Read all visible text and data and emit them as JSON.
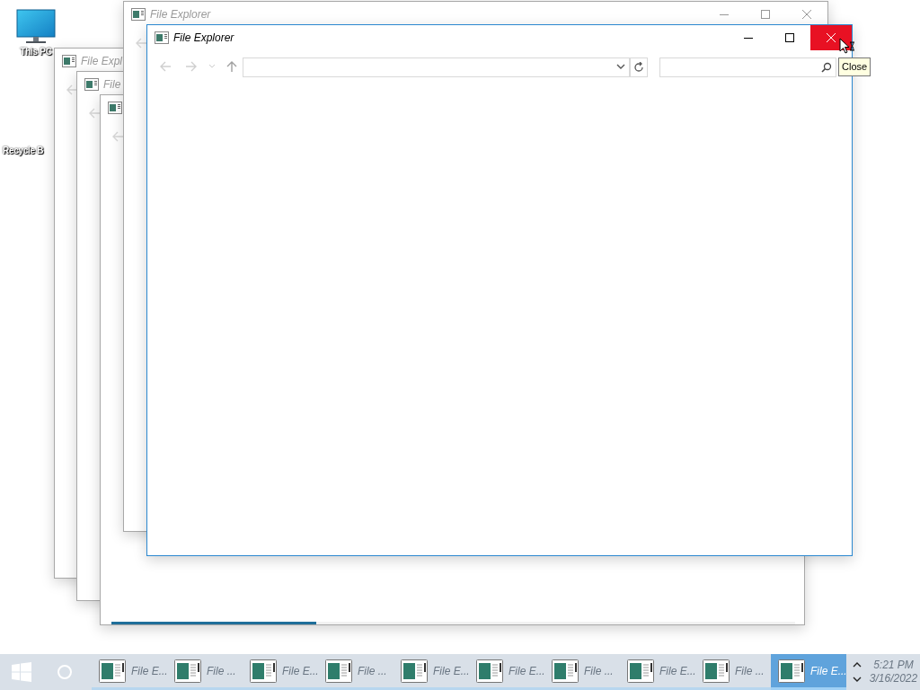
{
  "desktop_icons": [
    {
      "label": "This PC",
      "kind": "monitor"
    },
    {
      "label": "Recycle B",
      "kind": "hidden"
    }
  ],
  "windows": [
    {
      "title": "File Expl",
      "focused": false
    },
    {
      "title": "File",
      "focused": false
    },
    {
      "focused": false,
      "progress": {
        "level": 0.3
      }
    },
    {
      "title": "File Explorer",
      "focused": false,
      "controls": true
    },
    {
      "title": "File Explorer",
      "focused": true,
      "controls": true,
      "toolbar": true,
      "close_hovered": true,
      "tooltip": "Close"
    }
  ],
  "taskbar": {
    "items": [
      {
        "label": "File E...",
        "selected": false
      },
      {
        "label": "File ...",
        "selected": false
      },
      {
        "label": "File E...",
        "selected": false
      },
      {
        "label": "File ...",
        "selected": false
      },
      {
        "label": "File E...",
        "selected": false
      },
      {
        "label": "File E...",
        "selected": false
      },
      {
        "label": "File ...",
        "selected": false
      },
      {
        "label": "File E...",
        "selected": false
      },
      {
        "label": "File ...",
        "selected": false
      },
      {
        "label": "File E...",
        "selected": true
      }
    ],
    "time": "5:21 PM",
    "date": "3/16/2022"
  }
}
